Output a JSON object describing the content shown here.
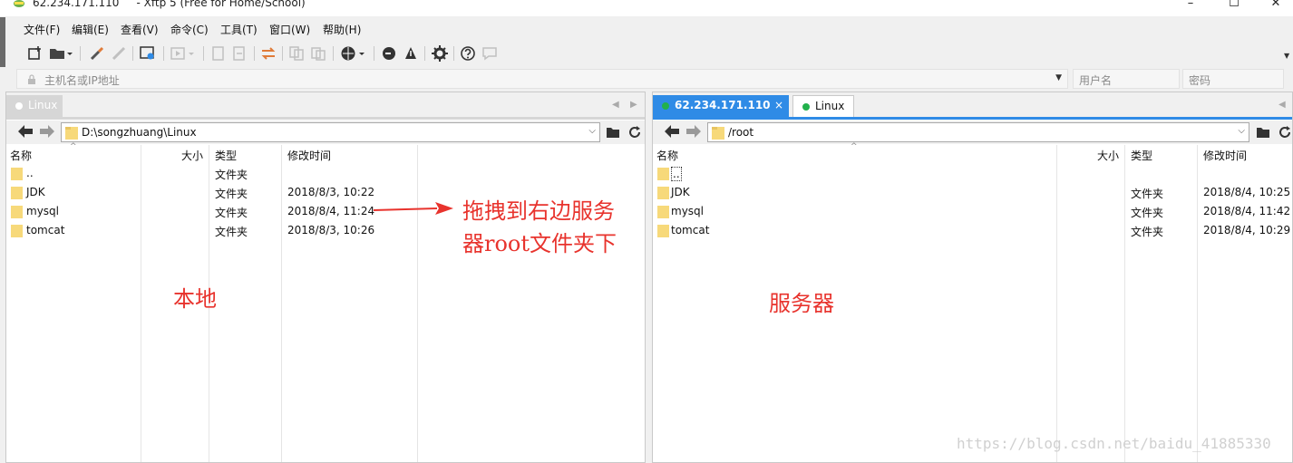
{
  "window": {
    "title": "62.234.171.110     - Xftp 5 (Free for Home/School)",
    "min_glyph": "–",
    "max_glyph": "☐",
    "close_glyph": "✕"
  },
  "menu": [
    "文件(F)",
    "编辑(E)",
    "查看(V)",
    "命令(C)",
    "工具(T)",
    "窗口(W)",
    "帮助(H)"
  ],
  "address": {
    "placeholder": "主机名或IP地址",
    "user_placeholder": "用户名",
    "pass_placeholder": "密码"
  },
  "local_pane": {
    "tab_label": "Linux",
    "path": "D:\\songzhuang\\Linux",
    "columns": [
      "名称",
      "大小",
      "类型",
      "修改时间"
    ],
    "rows": [
      {
        "name": "..",
        "size": "",
        "type": "文件夹",
        "modified": ""
      },
      {
        "name": "JDK",
        "size": "",
        "type": "文件夹",
        "modified": "2018/8/3, 10:22"
      },
      {
        "name": "mysql",
        "size": "",
        "type": "文件夹",
        "modified": "2018/8/4, 11:24"
      },
      {
        "name": "tomcat",
        "size": "",
        "type": "文件夹",
        "modified": "2018/8/3, 10:26"
      }
    ]
  },
  "remote_pane": {
    "tab_active": "62.234.171.110",
    "tab_other": "Linux",
    "path": "/root",
    "columns": [
      "名称",
      "大小",
      "类型",
      "修改时间"
    ],
    "rows": [
      {
        "name": "..",
        "size": "",
        "type": "",
        "modified": ""
      },
      {
        "name": "JDK",
        "size": "",
        "type": "文件夹",
        "modified": "2018/8/4, 10:25"
      },
      {
        "name": "mysql",
        "size": "",
        "type": "文件夹",
        "modified": "2018/8/4, 11:42"
      },
      {
        "name": "tomcat",
        "size": "",
        "type": "文件夹",
        "modified": "2018/8/4, 10:29"
      }
    ]
  },
  "annotations": {
    "drag_line1": "拖拽到右边服务",
    "drag_line2": "器root文件夹下",
    "local": "本地",
    "server": "服务器"
  },
  "watermark": "https://blog.csdn.net/baidu_41885330",
  "colors": {
    "accent": "#2f8be6",
    "annotation": "#e8332d",
    "folder": "#f7d97a",
    "status_ok": "#22b14c"
  }
}
